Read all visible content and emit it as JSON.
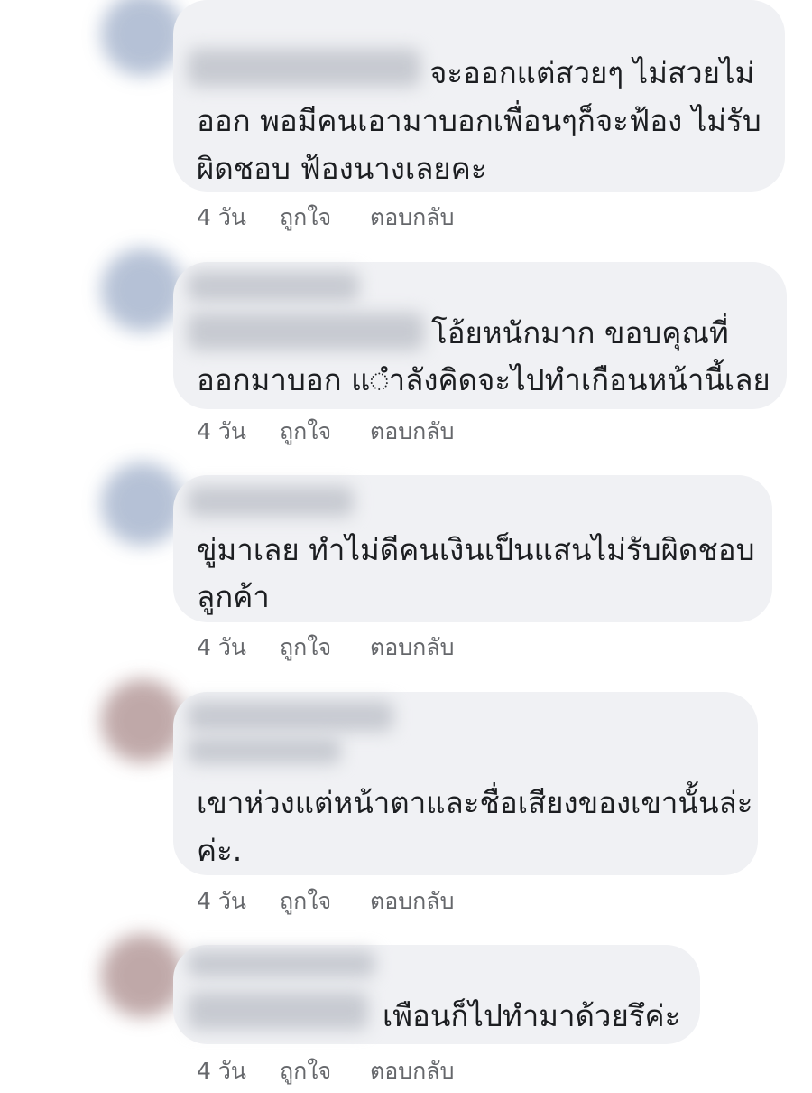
{
  "comments": [
    {
      "text_lines": [
        "จะออกแต่สวยๆ ไม่สวยไม่",
        "ออก พอมีคนเอามาบอกเพื่อนๆก็จะฟ้อง ไม่รับ",
        "ผิดชอบ ฟ้องนางเลยคะ"
      ],
      "time": "4 วัน",
      "like_label": "ถูกใจ",
      "reply_label": "ตอบกลับ"
    },
    {
      "text_lines": [
        "โอ้ยหนักมาก ขอบคุณที่",
        "ออกมาบอก แ◌ำลังคิดจะไปทำเกือนหน้านี้เลย"
      ],
      "time": "4 วัน",
      "like_label": "ถูกใจ",
      "reply_label": "ตอบกลับ"
    },
    {
      "text_lines": [
        "ขู่มาเลย ทำไม่ดีคนเงินเป็นแสนไม่รับผิดชอบ",
        "ลูกค้า"
      ],
      "time": "4 วัน",
      "like_label": "ถูกใจ",
      "reply_label": "ตอบกลับ"
    },
    {
      "text_lines": [
        "เขาห่วงแต่หน้าตาและชื่อเสียงของเขานั้นล่ะ",
        "ค่ะ."
      ],
      "time": "4 วัน",
      "like_label": "ถูกใจ",
      "reply_label": "ตอบกลับ"
    },
    {
      "text_lines": [
        "เพือนก็ไปทำมาด้วยรึค่ะ"
      ],
      "time": "4 วัน",
      "like_label": "ถูกใจ",
      "reply_label": "ตอบกลับ"
    }
  ],
  "colors": {
    "bubble": "#f0f1f4",
    "text": "#1c1e21",
    "meta": "#65676b",
    "avatar_blue": "#a9b7cf",
    "avatar_rose": "#b59a9a"
  }
}
